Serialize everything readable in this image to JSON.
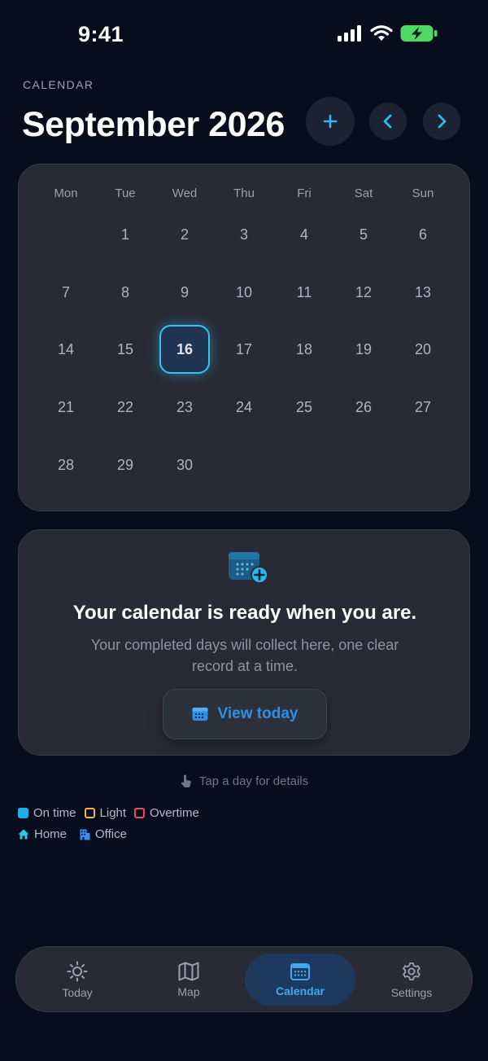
{
  "status_bar": {
    "time": "9:41"
  },
  "header": {
    "eyebrow": "CALENDAR",
    "month_title": "September 2026"
  },
  "calendar": {
    "weekdays": [
      "Mon",
      "Tue",
      "Wed",
      "Thu",
      "Fri",
      "Sat",
      "Sun"
    ],
    "days": [
      "1",
      "2",
      "3",
      "4",
      "5",
      "6",
      "7",
      "8",
      "9",
      "10",
      "11",
      "12",
      "13",
      "14",
      "15",
      "16",
      "17",
      "18",
      "19",
      "20",
      "21",
      "22",
      "23",
      "24",
      "25",
      "26",
      "27",
      "28",
      "29",
      "30"
    ],
    "today": "16"
  },
  "empty_state": {
    "title": "Your calendar is ready when you are.",
    "subtitle": "Your completed days will collect here, one clear record at a time.",
    "button_label": "View today"
  },
  "hint": {
    "text": "Tap a day for details"
  },
  "legend": {
    "on_time": "On time",
    "light": "Light",
    "overtime": "Overtime",
    "home": "Home",
    "office": "Office"
  },
  "tabs": [
    {
      "label": "Today"
    },
    {
      "label": "Map"
    },
    {
      "label": "Calendar"
    },
    {
      "label": "Settings"
    }
  ],
  "colors": {
    "background": "#070d1c",
    "card": "#282b36",
    "accent": "#38c2f0",
    "on_time": "#1fb0ea",
    "light": "#f0b74a",
    "overtime": "#ea4a6c",
    "home": "#38c2f0",
    "office": "#3a8ef0"
  }
}
